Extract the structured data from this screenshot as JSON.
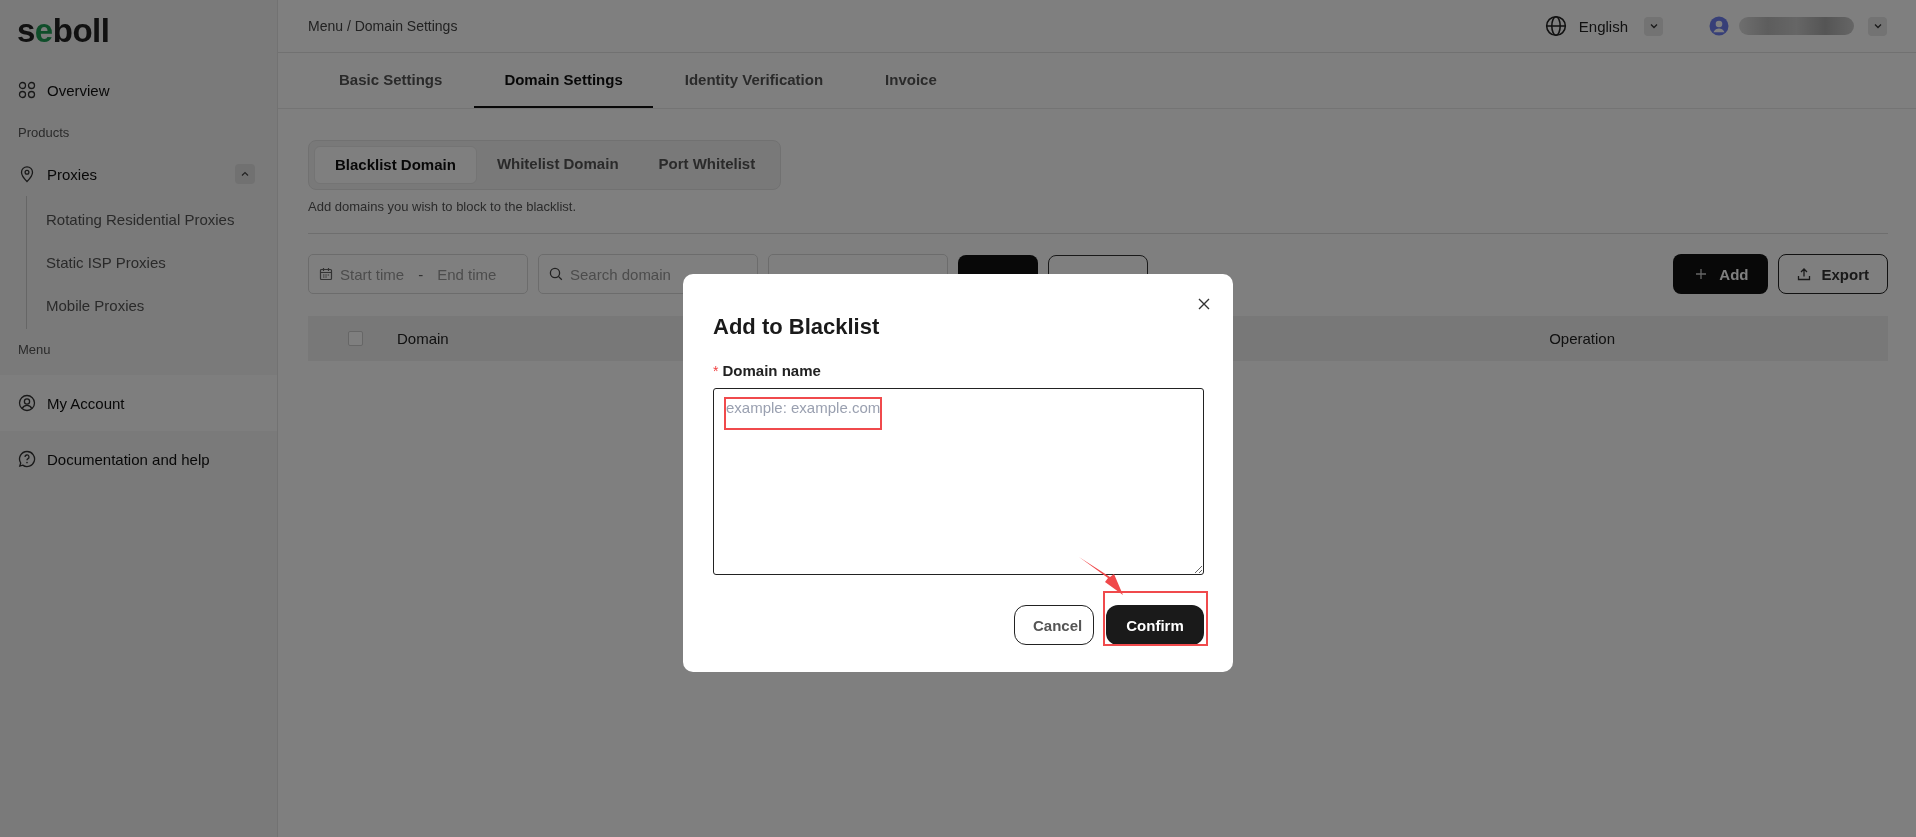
{
  "logo": {
    "parts": [
      {
        "text": "s",
        "accent": false
      },
      {
        "text": "e",
        "accent": true
      },
      {
        "text": "boll",
        "accent": false
      }
    ]
  },
  "sidebar": {
    "items": [
      {
        "kind": "link",
        "label": "Overview",
        "selected": false
      },
      {
        "kind": "heading",
        "label": "Products"
      },
      {
        "kind": "group",
        "label": "Proxies",
        "expanded": true,
        "children": [
          {
            "label": "Rotating Residential Proxies"
          },
          {
            "label": "Static ISP Proxies"
          },
          {
            "label": "Mobile Proxies"
          }
        ]
      },
      {
        "kind": "heading",
        "label": "Menu"
      },
      {
        "kind": "link",
        "label": "My Account",
        "selected": true
      },
      {
        "kind": "link",
        "label": "Documentation and help",
        "selected": false
      }
    ]
  },
  "header": {
    "breadcrumb": "Menu / Domain Settings",
    "language": "English"
  },
  "tabs": [
    {
      "label": "Basic Settings",
      "selected": false
    },
    {
      "label": "Domain Settings",
      "selected": true
    },
    {
      "label": "Identity Verification",
      "selected": false
    },
    {
      "label": "Invoice",
      "selected": false
    }
  ],
  "subtabs": [
    {
      "label": "Blacklist Domain",
      "selected": true
    },
    {
      "label": "Whitelist Domain",
      "selected": false
    },
    {
      "label": "Port Whitelist",
      "selected": false
    }
  ],
  "description": "Add domains you wish to block to the blacklist.",
  "filters": {
    "start_placeholder": "Start time",
    "separator": "-",
    "end_placeholder": "End time",
    "search_placeholder": "Search domain"
  },
  "actions": [
    {
      "kind": "primary",
      "label": "Add"
    },
    {
      "kind": "outline",
      "label": "Export"
    }
  ],
  "table": {
    "select_all_checked": false,
    "columns": [
      "Domain",
      "Operation"
    ]
  },
  "modal": {
    "title": "Add to Blacklist",
    "field_label": "Domain name",
    "required_mark": "*",
    "placeholder": "example: example.com",
    "buttons": [
      {
        "kind": "secondary",
        "label": "Cancel"
      },
      {
        "kind": "primary",
        "label": "Confirm"
      }
    ],
    "annotations": [
      {
        "kind": "field-highlight"
      },
      {
        "kind": "button-highlight"
      },
      {
        "kind": "pointer-arrow"
      }
    ]
  }
}
